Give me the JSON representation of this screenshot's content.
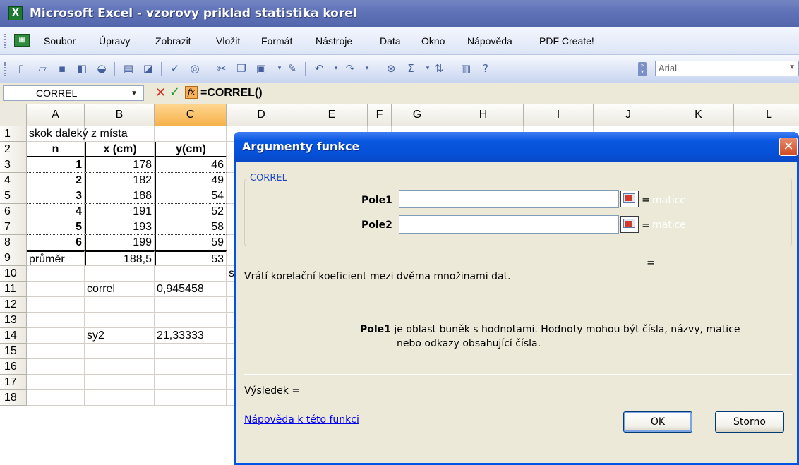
{
  "window": {
    "title": "Microsoft Excel - vzorovy priklad statistika korel",
    "app_icon": "X"
  },
  "menu": {
    "items": [
      {
        "label": "Soubor"
      },
      {
        "label": "Úpravy"
      },
      {
        "label": "Zobrazit"
      },
      {
        "label": "Vložit"
      },
      {
        "label": "Formát"
      },
      {
        "label": "Nástroje"
      },
      {
        "label": "Data"
      },
      {
        "label": "Okno"
      },
      {
        "label": "Nápověda"
      },
      {
        "label": "PDF Create!"
      }
    ]
  },
  "toolbar": {
    "font_name": "Arial"
  },
  "formula_bar": {
    "name_box": "CORREL",
    "formula": "=CORREL()"
  },
  "columns": [
    "A",
    "B",
    "C",
    "D",
    "E",
    "F",
    "G",
    "H",
    "I",
    "J",
    "K",
    "L"
  ],
  "active_column": "C",
  "rows": [
    "1",
    "2",
    "3",
    "4",
    "5",
    "6",
    "7",
    "8",
    "9",
    "10",
    "11",
    "12",
    "13",
    "14",
    "15",
    "16",
    "17",
    "18"
  ],
  "sheet": {
    "a1": "skok daleký z místa",
    "header": {
      "n": "n",
      "x": "x (cm)",
      "y": "y(cm)"
    },
    "data": [
      {
        "n": "1",
        "x": "178",
        "y": "46"
      },
      {
        "n": "2",
        "x": "182",
        "y": "49"
      },
      {
        "n": "3",
        "x": "188",
        "y": "54"
      },
      {
        "n": "4",
        "x": "191",
        "y": "52"
      },
      {
        "n": "5",
        "x": "193",
        "y": "58"
      },
      {
        "n": "6",
        "x": "199",
        "y": "59"
      }
    ],
    "mean_label": "průměr",
    "mean_x": "188,5",
    "mean_y": "53",
    "correl_label": "correl",
    "correl_value": "0,945458",
    "sy2_label": "sy2",
    "sy2_value": "21,33333",
    "d10_partial": "s"
  },
  "dialog": {
    "title": "Argumenty funkce",
    "close_label": "✕",
    "group_label": "CORREL",
    "args": [
      {
        "label": "Pole1",
        "value": "",
        "result": "matice"
      },
      {
        "label": "Pole2",
        "value": "",
        "result": "matice"
      }
    ],
    "eq_sign": "=",
    "description": "Vrátí korelační koeficient mezi dvěma množinami dat.",
    "arg_help_name": "Pole1",
    "arg_help_line1": "je oblast buněk s hodnotami. Hodnoty mohou být čísla, názvy, matice",
    "arg_help_line2": "nebo odkazy obsahující čísla.",
    "result_label": "Výsledek =",
    "help_link": "Nápověda k této funkci",
    "ok_label": "OK",
    "cancel_label": "Storno"
  },
  "colors": {
    "title_bar": "#6577bb",
    "dialog_title": "#0551d8",
    "dialog_bg": "#ece9d8",
    "active_header": "#f6b24a"
  }
}
